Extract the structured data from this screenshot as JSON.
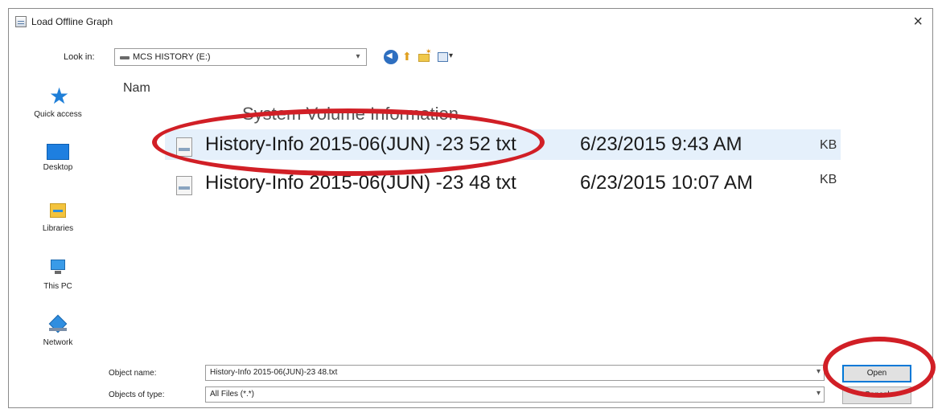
{
  "dialog": {
    "title": "Load Offline Graph",
    "close_glyph": "×"
  },
  "toolbar": {
    "look_in_label": "Look in:",
    "look_in_value": "MCS HISTORY (E:)",
    "icons": [
      "back-icon",
      "up-folder-icon",
      "new-folder-icon",
      "view-menu-icon"
    ]
  },
  "places": [
    {
      "label": "Quick access",
      "icon": "quick-access-icon"
    },
    {
      "label": "Desktop",
      "icon": "desktop-icon"
    },
    {
      "label": "Libraries",
      "icon": "libraries-icon"
    },
    {
      "label": "This PC",
      "icon": "this-pc-icon"
    },
    {
      "label": "Network",
      "icon": "network-icon"
    }
  ],
  "file_list": {
    "name_header": "Nam",
    "folder": "System Volume Information",
    "files": [
      {
        "name": "History-Info 2015-06(JUN) -23  52 txt",
        "date": "6/23/2015 9:43 AM",
        "size_unit": "KB",
        "selected": true
      },
      {
        "name": "History-Info 2015-06(JUN) -23  48 txt",
        "date": "6/23/2015 10:07 AM",
        "size_unit": "KB",
        "selected": false
      }
    ]
  },
  "bottom": {
    "object_name_label": "Object name:",
    "object_name_value": "History-Info 2015-06(JUN)-23  48.txt",
    "objects_type_label": "Objects of type:",
    "objects_type_value": "All Files (*.*)",
    "open_label": "Open",
    "cancel_label": "Cancel"
  },
  "colors": {
    "highlight_oval": "#d11f26",
    "selection": "#e5f0fb",
    "accent": "#0078d7"
  }
}
